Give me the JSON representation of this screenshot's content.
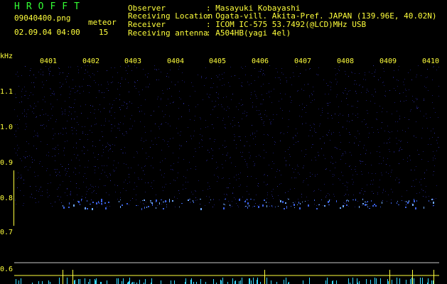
{
  "header": {
    "brand": "HROFFT",
    "filename": "09040400.png",
    "timestamp": "02.09.04 04:00",
    "meteor_label": "meteor",
    "meteor_count": "15",
    "info_rows": [
      {
        "label": "Observer",
        "value": ": Masayuki Kobayashi"
      },
      {
        "label": "Receiving Location",
        "value": ": Ogata-vill. Akita-Pref. JAPAN (139.96E, 40.02N)"
      },
      {
        "label": "Receiver",
        "value": ": ICOM IC-575 53.7492(@LCD)MHz USB"
      },
      {
        "label": "Receiving antenna",
        "value": ": A504HB(yagi 4el)"
      }
    ]
  },
  "spectrogram": {
    "y_unit": "kHz",
    "y_ticks": [
      "1.1",
      "1.0",
      "0.9",
      "0.8",
      "0.7",
      "0.6"
    ],
    "x_ticks": [
      "0401",
      "0402",
      "0403",
      "0404",
      "0405",
      "0406",
      "0407",
      "0408",
      "0409",
      "0410"
    ],
    "background_color": "#000000",
    "noise_color": "#1a1a6a",
    "signal_color": "#6fa8ff",
    "label_color": "#ffff3c"
  }
}
